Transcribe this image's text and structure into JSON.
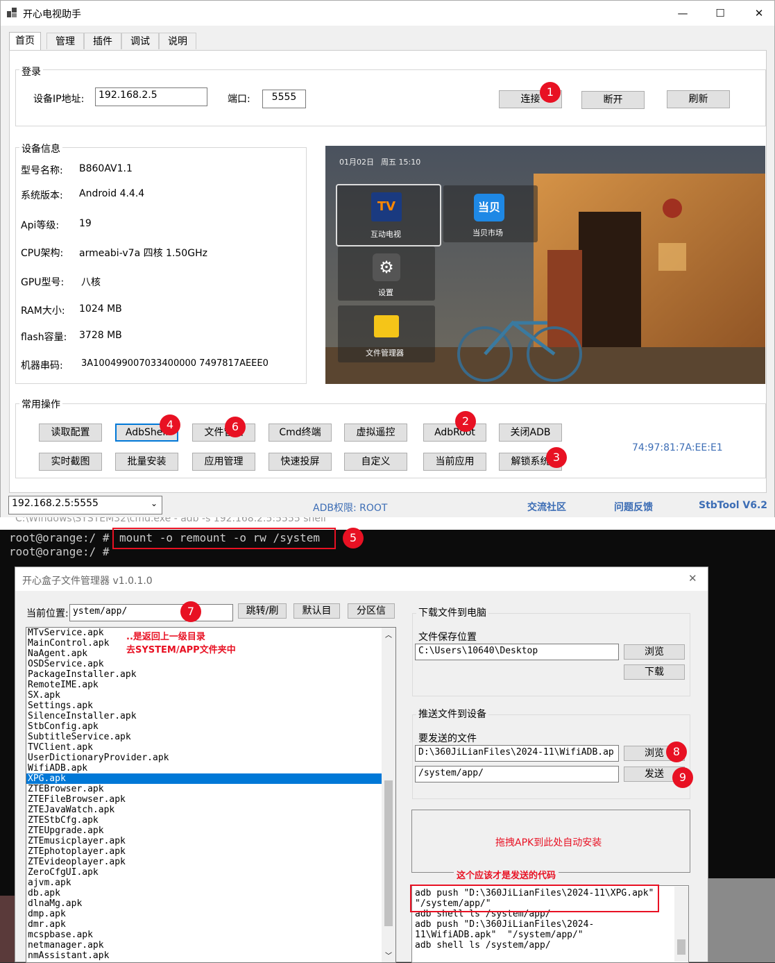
{
  "app": {
    "title": "开心电视助手",
    "tabs": [
      "首页",
      "管理",
      "插件",
      "调试",
      "说明"
    ],
    "login": {
      "group_label": "登录",
      "ip_label": "设备IP地址:",
      "ip_value": "192.168.2.5",
      "port_label": "端口:",
      "port_value": "5555",
      "connect_label": "连接",
      "disconnect_label": "断开",
      "refresh_label": "刷新"
    },
    "device_info": {
      "group_label": "设备信息",
      "rows": [
        {
          "label": "型号名称:",
          "value": "B860AV1.1"
        },
        {
          "label": "系统版本:",
          "value": "Android 4.4.4"
        },
        {
          "label": "Api等级:",
          "value": "19"
        },
        {
          "label": "CPU架构:",
          "value": "armeabi-v7a 四核 1.50GHz"
        },
        {
          "label": "GPU型号:",
          "value": "八核"
        },
        {
          "label": "RAM大小:",
          "value": "1024 MB"
        },
        {
          "label": "flash容量:",
          "value": "3728 MB"
        },
        {
          "label": "机器串码:",
          "value": "3A100499007033400000 7497817AEEE0"
        }
      ]
    },
    "tv_screen": {
      "date": "01月02日",
      "weekday_time": "周五 15:10",
      "apps": [
        "互动电视",
        "当贝市场",
        "设置",
        "文件管理器"
      ]
    },
    "ops": {
      "group_label": "常用操作",
      "row1": [
        "读取配置",
        "AdbShell",
        "文件管理",
        "Cmd终端",
        "虚拟遥控",
        "AdbRoot",
        "关闭ADB"
      ],
      "row2": [
        "实时截图",
        "批量安装",
        "应用管理",
        "快速投屏",
        "自定义",
        "当前应用",
        "解锁系统"
      ],
      "mac": "74:97:81:7A:EE:E1"
    },
    "status": {
      "device_select": "192.168.2.5:5555",
      "adb_perm": "ADB权限: ROOT",
      "community": "交流社区",
      "feedback": "问题反馈",
      "version": "StbTool V6.2"
    },
    "badges": [
      "1",
      "2",
      "3",
      "4",
      "5",
      "6",
      "7",
      "8",
      "9"
    ]
  },
  "cmd": {
    "title": "C:\\Windows\\SYSTEM32\\cmd.exe - adb -s 192.168.2.5:5555 shell",
    "prompt1": "root@orange:/ #",
    "command1": "mount -o remount -o rw /system",
    "prompt2": "root@orange:/ #"
  },
  "file_manager": {
    "title": "开心盒子文件管理器 v1.0.1.0",
    "location_label": "当前位置:",
    "location_value": "ystem/app/",
    "btn_goto": "跳转/刷",
    "btn_default": "默认目",
    "btn_partition": "分区信",
    "annotation1": "..是返回上一级目录",
    "annotation2": "去SYSTEM/APP文件夹中",
    "files": [
      "MTvService.apk",
      "MainControl.apk",
      "NaAgent.apk",
      "OSDService.apk",
      "PackageInstaller.apk",
      "RemoteIME.apk",
      "SX.apk",
      "Settings.apk",
      "SilenceInstaller.apk",
      "StbConfig.apk",
      "SubtitleService.apk",
      "TVClient.apk",
      "UserDictionaryProvider.apk",
      "WifiADB.apk",
      "XPG.apk",
      "ZTEBrowser.apk",
      "ZTEFileBrowser.apk",
      "ZTEJavaWatch.apk",
      "ZTEStbCfg.apk",
      "ZTEUpgrade.apk",
      "ZTEmusicplayer.apk",
      "ZTEphotoplayer.apk",
      "ZTEvideoplayer.apk",
      "ZeroCfgUI.apk",
      "ajvm.apk",
      "db.apk",
      "dlnaMg.apk",
      "dmp.apk",
      "dmr.apk",
      "mcspbase.apk",
      "netmanager.apk",
      "nmAssistant.apk"
    ],
    "selected_file": "XPG.apk",
    "download": {
      "group_label": "下载文件到电脑",
      "save_label": "文件保存位置",
      "save_value": "C:\\Users\\10640\\Desktop",
      "browse": "浏览",
      "download": "下载"
    },
    "push": {
      "group_label": "推送文件到设备",
      "file_label": "要发送的文件",
      "file_value": "D:\\360JiLianFiles\\2024-11\\WifiADB.ap",
      "target_value": "/system/app/",
      "browse": "浏览",
      "send": "发送"
    },
    "drop_zone": "拖拽APK到此处自动安装",
    "annotation3": "这个应该才是发送的代码",
    "log_lines": [
      "adb push \"D:\\360JiLianFiles\\2024-11\\XPG.apk\"",
      "\"/system/app/\"",
      "adb shell ls /system/app/",
      "adb push \"D:\\360JiLianFiles\\2024-",
      "11\\WifiADB.apk\"  \"/system/app/\"",
      "adb shell ls /system/app/"
    ]
  },
  "colors": {
    "accent": "#0078d7",
    "badge": "#e81123",
    "link": "#3c6db5"
  }
}
